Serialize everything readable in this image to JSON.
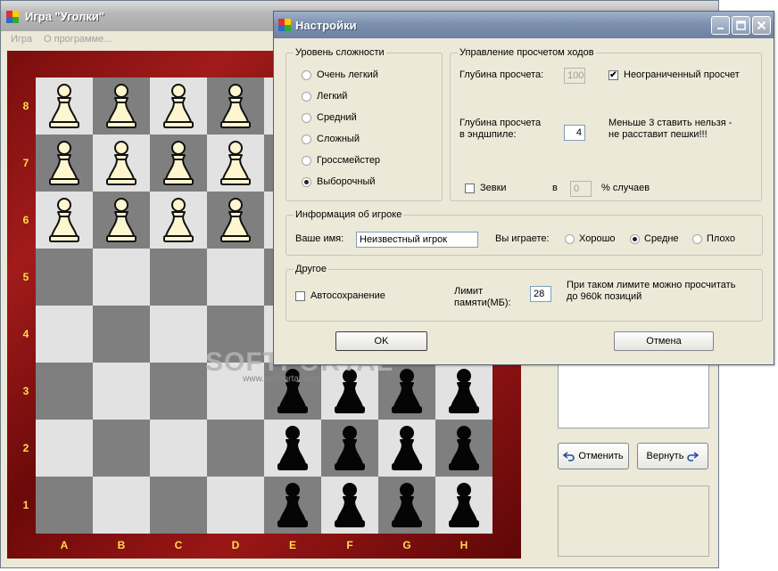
{
  "main_window": {
    "title": "Игра \"Уголки\"",
    "menu": [
      "Игра",
      "О программе..."
    ]
  },
  "board": {
    "files": [
      "A",
      "B",
      "C",
      "D",
      "E",
      "F",
      "G",
      "H"
    ],
    "ranks": [
      "8",
      "7",
      "6",
      "5",
      "4",
      "3",
      "2",
      "1"
    ],
    "white_pawns": [
      "A8",
      "B8",
      "C8",
      "D8",
      "A7",
      "B7",
      "C7",
      "D7",
      "A6",
      "B6",
      "C6",
      "D6"
    ],
    "black_pawns": [
      "E3",
      "F3",
      "G3",
      "H3",
      "E2",
      "F2",
      "G2",
      "H2",
      "E1",
      "F1",
      "G1",
      "H1"
    ],
    "colors": {
      "light_square": "#e2e2e2",
      "dark_square": "#7f7f7f",
      "frame": "#8b1010",
      "labels": "#ffde4d"
    }
  },
  "side_panel": {
    "undo_label": "Отменить",
    "redo_label": "Вернуть"
  },
  "settings_dialog": {
    "title": "Настройки",
    "difficulty": {
      "caption": "Уровень сложности",
      "options": [
        "Очень легкий",
        "Легкий",
        "Средний",
        "Сложный",
        "Гроссмейстер",
        "Выборочный"
      ],
      "selected": "Выборочный"
    },
    "search": {
      "caption": "Управление просчетом ходов",
      "depth_label": "Глубина просчета:",
      "depth_value": "100",
      "unlimited_label": "Неограниченный просчет",
      "unlimited_checked": true,
      "endgame_label_line1": "Глубина просчета",
      "endgame_label_line2": "в эндшпиле:",
      "endgame_value": "4",
      "endgame_note_line1": "Меньше 3 ставить нельзя -",
      "endgame_note_line2": "не расставит пешки!!!",
      "blunders_label": "Зевки",
      "blunders_checked": false,
      "in_label": "в",
      "blunders_value": "0",
      "percent_label": "% случаев"
    },
    "player": {
      "caption": "Информация об игроке",
      "name_label": "Ваше имя:",
      "name_value": "Неизвестный игрок",
      "skill_label": "Вы играете:",
      "skill_options": [
        "Хорошо",
        "Средне",
        "Плохо"
      ],
      "skill_selected": "Средне"
    },
    "other": {
      "caption": "Другое",
      "autosave_label": "Автосохранение",
      "autosave_checked": false,
      "memory_label_line1": "Лимит",
      "memory_label_line2": "памяти(МБ):",
      "memory_value": "28",
      "memory_note_line1": "При таком лимите можно просчитать",
      "memory_note_line2": "до 960k позиций"
    },
    "ok_label": "OK",
    "cancel_label": "Отмена"
  },
  "watermark": {
    "text": "SOFTPORTAL",
    "url": "www.softportal.com"
  }
}
